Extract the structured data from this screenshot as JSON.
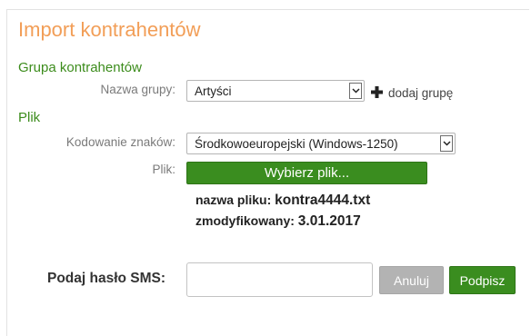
{
  "page": {
    "title": "Import kontrahentów"
  },
  "group_section": {
    "heading": "Grupa kontrahentów",
    "name_label": "Nazwa grupy:",
    "selected_group": "Artyści",
    "add_group_label": "dodaj grupę"
  },
  "file_section": {
    "heading": "Plik",
    "encoding_label": "Kodowanie znaków:",
    "selected_encoding": "Środkowoeuropejski (Windows-1250)",
    "file_label": "Plik:",
    "choose_file_label": "Wybierz plik...",
    "file_name_label": "nazwa pliku:",
    "file_name_value": "kontra4444.txt",
    "modified_label": "zmodyfikowany:",
    "modified_value": "3.01.2017"
  },
  "sms": {
    "label": "Podaj hasło SMS:",
    "value": "",
    "cancel_label": "Anuluj",
    "sign_label": "Podpisz"
  },
  "colors": {
    "title": "#f29e57",
    "section_heading": "#3c8c1c",
    "primary_button": "#3a8d1f",
    "disabled_button": "#b3b3b3"
  },
  "icons": {
    "dropdown": "chevron-down-icon",
    "add": "plus-icon"
  }
}
